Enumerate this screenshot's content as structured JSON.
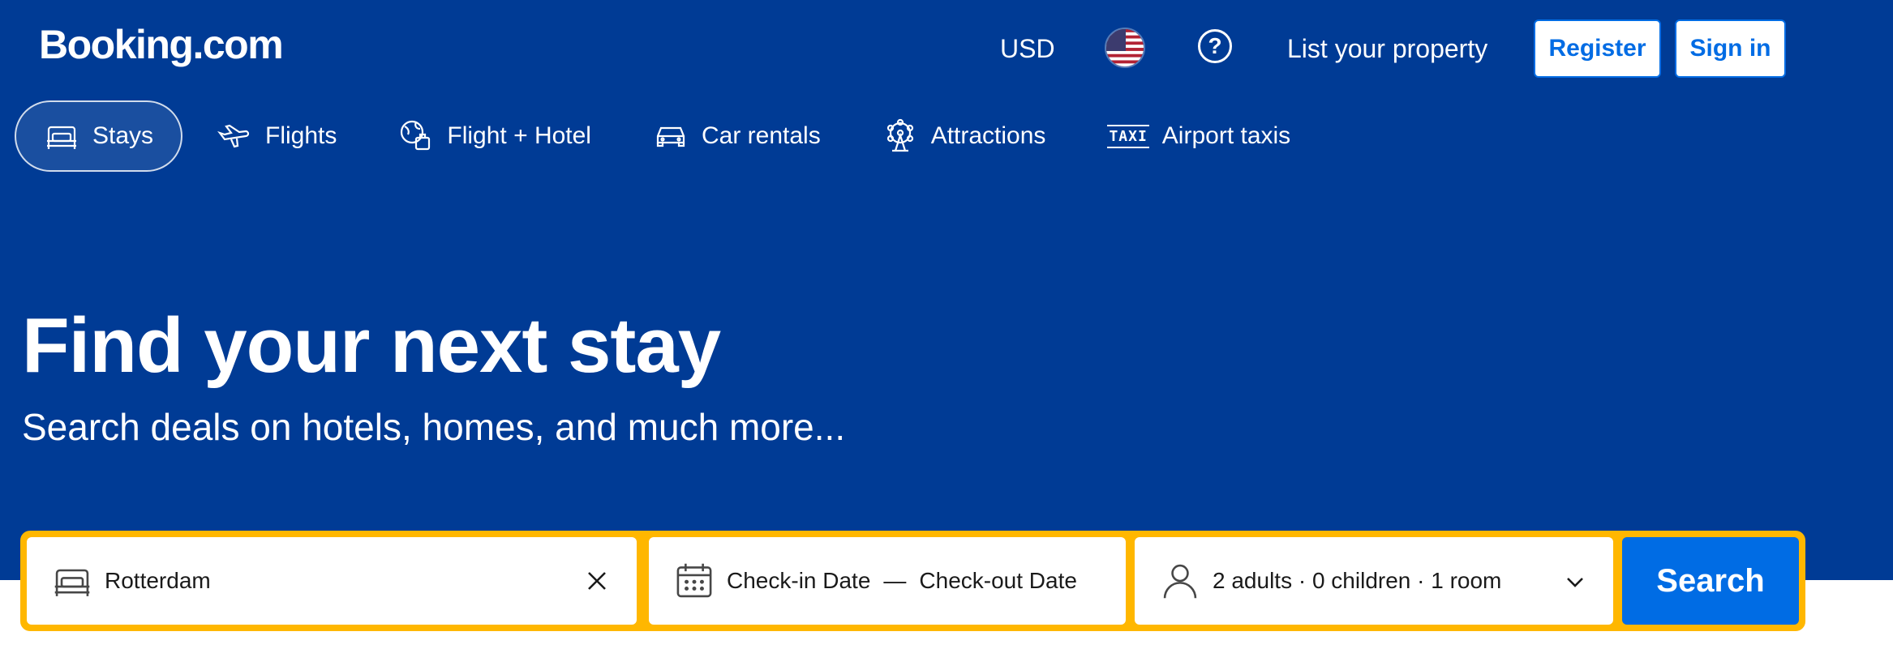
{
  "header": {
    "logo": "Booking.com",
    "currency": "USD",
    "language_icon": "us-flag-icon",
    "help_icon": "question-circle-icon",
    "list_property": "List your property",
    "register": "Register",
    "sign_in": "Sign in"
  },
  "tabs": [
    {
      "label": "Stays",
      "icon": "bed-icon",
      "active": true
    },
    {
      "label": "Flights",
      "icon": "plane-icon",
      "active": false
    },
    {
      "label": "Flight + Hotel",
      "icon": "globe-luggage-icon",
      "active": false
    },
    {
      "label": "Car rentals",
      "icon": "car-icon",
      "active": false
    },
    {
      "label": "Attractions",
      "icon": "ferris-wheel-icon",
      "active": false
    },
    {
      "label": "Airport taxis",
      "icon": "taxi-icon",
      "active": false
    }
  ],
  "hero": {
    "title": "Find your next stay",
    "subtitle": "Search deals on hotels, homes, and much more..."
  },
  "search": {
    "destination_value": "Rotterdam",
    "checkin_placeholder": "Check-in Date",
    "date_separator": "—",
    "checkout_placeholder": "Check-out Date",
    "occupancy": "2 adults · 0 children · 1 room",
    "search_label": "Search"
  },
  "colors": {
    "brand_blue": "#003b95",
    "action_blue": "#006ce4",
    "highlight_yellow": "#ffb700"
  }
}
